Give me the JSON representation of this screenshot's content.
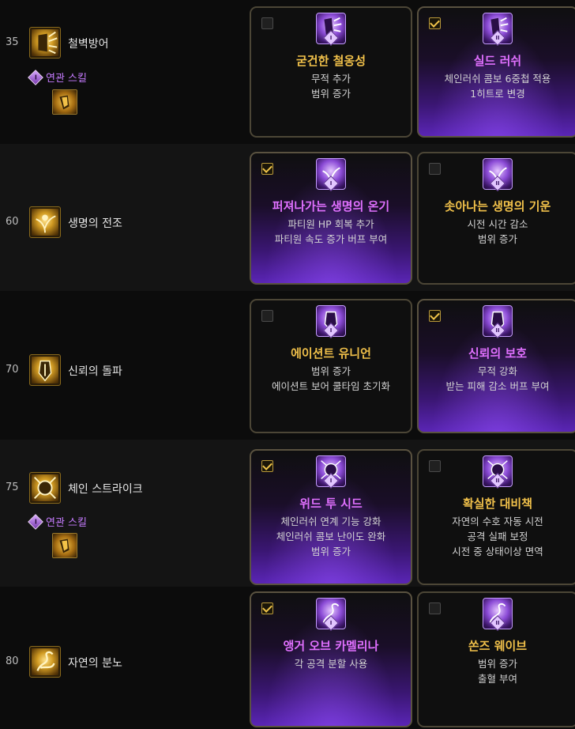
{
  "rows": [
    {
      "level": "35",
      "skill": "철벽방어",
      "skill_icon": "shield-wall-icon",
      "related_label": "연관 스킬",
      "related_badge": "I",
      "related_icon": "shield-icon",
      "options": [
        {
          "tier": "I",
          "checked": false,
          "title": "굳건한 철옹성",
          "desc": [
            "무적 추가",
            "범위 증가"
          ],
          "icon": "knight-shield-icon"
        },
        {
          "tier": "II",
          "checked": true,
          "title": "실드 러쉬",
          "desc": [
            "체인러쉬 콤보 6중첩 적용",
            "1히트로 변경"
          ],
          "icon": "knight-shield-icon"
        }
      ]
    },
    {
      "level": "60",
      "skill": "생명의 전조",
      "skill_icon": "life-sprout-icon",
      "options": [
        {
          "tier": "I",
          "checked": true,
          "title": "퍼져나가는 생명의 온기",
          "desc": [
            "파티원 HP 회복 추가",
            "파티원 속도 증가 버프 부여"
          ],
          "icon": "sprout-icon"
        },
        {
          "tier": "II",
          "checked": false,
          "title": "솟아나는 생명의 기운",
          "desc": [
            "시전 시간 감소",
            "범위 증가"
          ],
          "icon": "sprout-icon"
        }
      ]
    },
    {
      "level": "70",
      "skill": "신뢰의 돌파",
      "skill_icon": "trust-shield-icon",
      "options": [
        {
          "tier": "I",
          "checked": false,
          "title": "에이션트 유니언",
          "desc": [
            "범위 증가",
            "에이션트 보어 쿨타임 초기화"
          ],
          "icon": "tower-shield-icon"
        },
        {
          "tier": "II",
          "checked": true,
          "title": "신뢰의 보호",
          "desc": [
            "무적 강화",
            "받는 피해 감소 버프 부여"
          ],
          "icon": "tower-shield-icon"
        }
      ]
    },
    {
      "level": "75",
      "skill": "체인 스트라이크",
      "skill_icon": "chain-strike-icon",
      "related_label": "연관 스킬",
      "related_badge": "I",
      "related_icon": "shield-icon",
      "options": [
        {
          "tier": "I",
          "checked": true,
          "title": "위드 투 시드",
          "desc": [
            "체인러쉬 연계 기능 강화",
            "체인러쉬 콤보 난이도 완화",
            "범위 증가"
          ],
          "icon": "burst-icon"
        },
        {
          "tier": "II",
          "checked": false,
          "title": "확실한 대비책",
          "desc": [
            "자연의 수호 자동 시전",
            "공격 실패 보정",
            "시전 중 상태이상 면역"
          ],
          "icon": "burst-icon"
        }
      ]
    },
    {
      "level": "80",
      "skill": "자연의 분노",
      "skill_icon": "nature-wrath-icon",
      "options": [
        {
          "tier": "I",
          "checked": true,
          "title": "앵거 오브 카멜리나",
          "desc": [
            "각 공격 분할 사용"
          ],
          "icon": "vine-icon"
        },
        {
          "tier": "II",
          "checked": false,
          "title": "쏜즈 웨이브",
          "desc": [
            "범위 증가",
            "출혈 부여"
          ],
          "icon": "vine-icon"
        }
      ]
    }
  ]
}
